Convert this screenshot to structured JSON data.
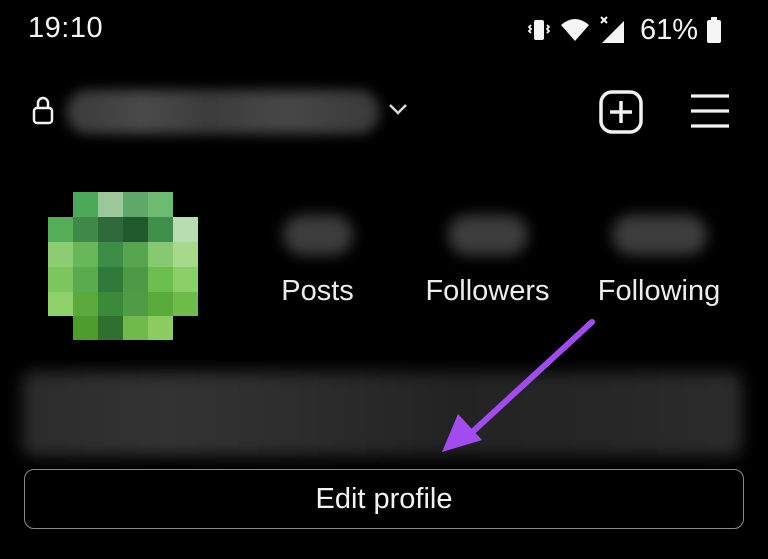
{
  "status_bar": {
    "time": "19:10",
    "battery_percent": "61%",
    "icons": [
      "vibrate-icon",
      "wifi-icon",
      "signal-icon",
      "battery-icon"
    ]
  },
  "header": {
    "lock_icon": "lock-icon",
    "dropdown_icon": "chevron-down-icon",
    "add_icon": "add-square-icon",
    "menu_icon": "hamburger-menu-icon"
  },
  "stats": {
    "posts_label": "Posts",
    "followers_label": "Followers",
    "following_label": "Following"
  },
  "actions": {
    "edit_profile_label": "Edit profile"
  },
  "annotation": {
    "arrow_color": "#a24cf0"
  },
  "colors": {
    "background": "#000000",
    "text": "#f2f2f2",
    "button_border": "#8a8a8a"
  }
}
